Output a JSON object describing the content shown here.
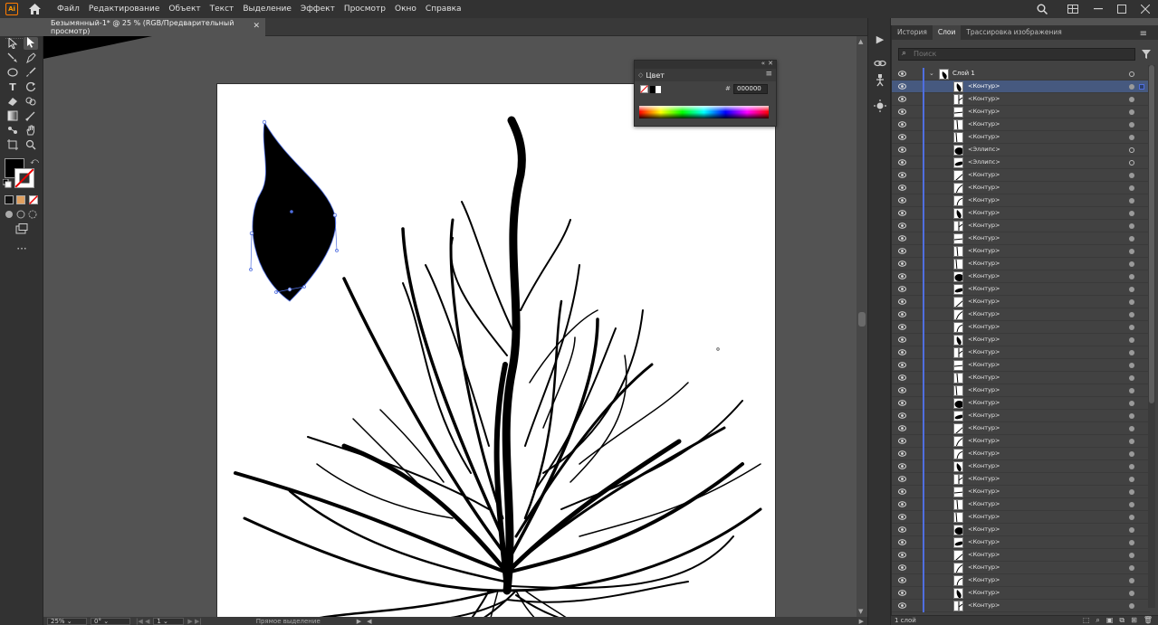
{
  "app": {
    "logo": "Ai"
  },
  "menubar": {
    "items": [
      "Файл",
      "Редактирование",
      "Объект",
      "Текст",
      "Выделение",
      "Эффект",
      "Просмотр",
      "Окно",
      "Справка"
    ]
  },
  "document": {
    "tab_title": "Безымянный-1* @ 25 % (RGB/Предварительный просмотр)"
  },
  "color_panel": {
    "title": "Цвет",
    "hex_label": "#",
    "hex_value": "000000"
  },
  "layers_panel": {
    "tabs": [
      "История",
      "Слои",
      "Трассировка изображения"
    ],
    "active_tab": "Слои",
    "search_placeholder": "Поиск",
    "layer_name": "Слой 1",
    "rows": [
      "<Контур>",
      "<Контур>",
      "<Контур>",
      "<Контур>",
      "<Контур>",
      "<Эллипс>",
      "<Эллипс>",
      "<Контур>",
      "<Контур>",
      "<Контур>",
      "<Контур>",
      "<Контур>",
      "<Контур>",
      "<Контур>",
      "<Контур>",
      "<Контур>",
      "<Контур>",
      "<Контур>",
      "<Контур>",
      "<Контур>",
      "<Контур>",
      "<Контур>",
      "<Контур>",
      "<Контур>",
      "<Контур>",
      "<Контур>",
      "<Контур>",
      "<Контур>",
      "<Контур>",
      "<Контур>",
      "<Контур>",
      "<Контур>",
      "<Контур>",
      "<Контур>",
      "<Контур>",
      "<Контур>",
      "<Контур>",
      "<Контур>",
      "<Контур>",
      "<Контур>",
      "<Контур>",
      "<Контур>"
    ],
    "footer_count": "1 слой"
  },
  "statusbar": {
    "zoom": "25%",
    "rotation": "0°",
    "artboard": "1",
    "tool_name": "Прямое выделение"
  },
  "colors": {
    "selection": "#4f6ee0",
    "ui_dark": "#323232",
    "ui_mid": "#424242",
    "canvas_bg": "#535353"
  },
  "icons": [
    "home-icon",
    "search-icon",
    "arrange-documents-icon",
    "window-minimize-icon",
    "window-maximize-icon",
    "window-close-icon",
    "selection-tool-icon",
    "direct-selection-tool-icon",
    "pen-tool-icon",
    "type-tool-icon",
    "rotate-tool-icon",
    "eye-icon",
    "filter-icon",
    "chevron-down-icon"
  ]
}
